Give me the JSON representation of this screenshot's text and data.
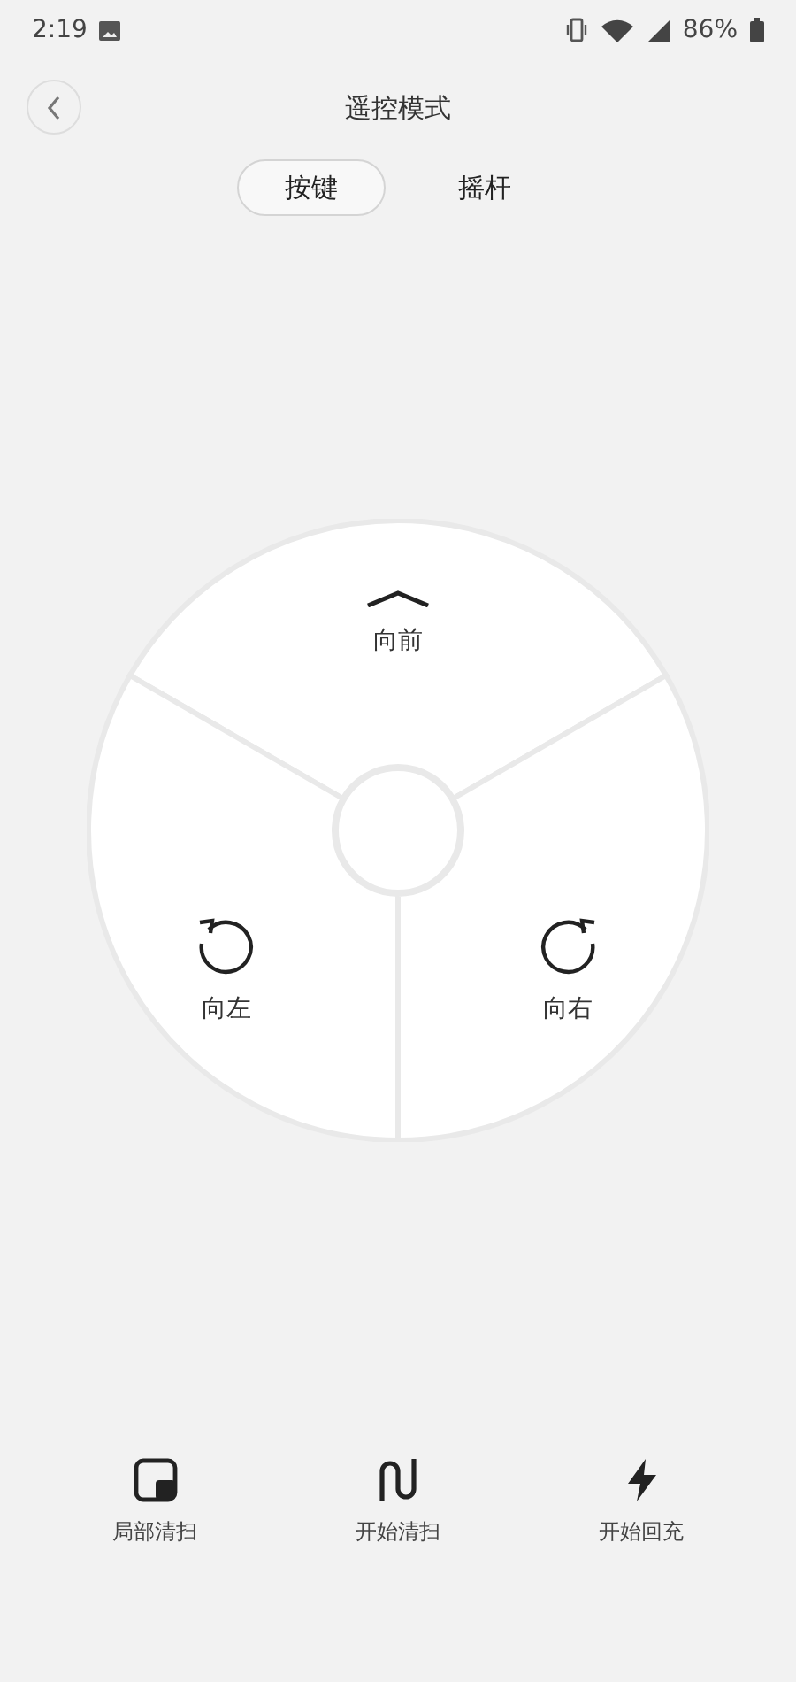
{
  "status_bar": {
    "time": "2:19",
    "battery": "86%"
  },
  "header": {
    "title": "遥控模式"
  },
  "tabs": [
    {
      "label": "按键",
      "selected": true
    },
    {
      "label": "摇杆",
      "selected": false
    }
  ],
  "wheel": {
    "buttons": [
      {
        "kind": "forward",
        "label": "向前"
      },
      {
        "kind": "left",
        "label": "向左"
      },
      {
        "kind": "right",
        "label": "向右"
      }
    ]
  },
  "actions": [
    {
      "kind": "spot",
      "label": "局部清扫"
    },
    {
      "kind": "clean",
      "label": "开始清扫"
    },
    {
      "kind": "charge",
      "label": "开始回充"
    }
  ]
}
